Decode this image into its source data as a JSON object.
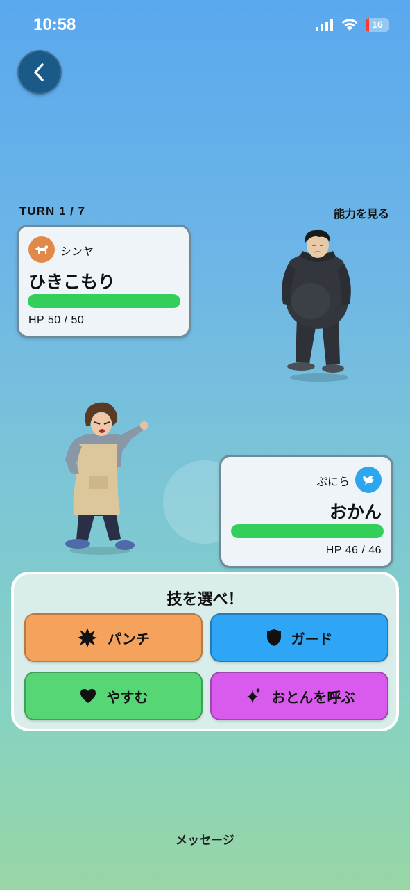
{
  "status_bar": {
    "time": "10:58",
    "battery_level": "16",
    "battery_color": "#ff3b30"
  },
  "nav": {
    "back_icon": "chevron-left-icon"
  },
  "battle": {
    "turn_label": "TURN 1 / 7",
    "ability_link": "能力を見る"
  },
  "player": {
    "owner_name": "シンヤ",
    "avatar_icon": "dog-icon",
    "character_name": "ひきこもり",
    "hp_text": "HP 50 / 50",
    "hp_current": 50,
    "hp_max": 50
  },
  "enemy": {
    "owner_name": "ぷにら",
    "avatar_icon": "bird-icon",
    "character_name": "おかん",
    "hp_text": "HP 46 / 46",
    "hp_current": 46,
    "hp_max": 46
  },
  "moves": {
    "title": "技を選べ！",
    "punch": {
      "label": "パンチ",
      "icon": "burst-icon",
      "color": "#f5a35c"
    },
    "guard": {
      "label": "ガード",
      "icon": "shield-icon",
      "color": "#2fa6f5"
    },
    "rest": {
      "label": "やすむ",
      "icon": "heart-icon",
      "color": "#57d676"
    },
    "call": {
      "label": "おとんを呼ぶ",
      "icon": "sparkle-icon",
      "color": "#d85bee"
    }
  },
  "footer": {
    "message_label": "メッセージ"
  },
  "colors": {
    "hp_bar": "#34cf5b",
    "card_border": "#6f8b99",
    "back_button": "#1a5a88"
  }
}
